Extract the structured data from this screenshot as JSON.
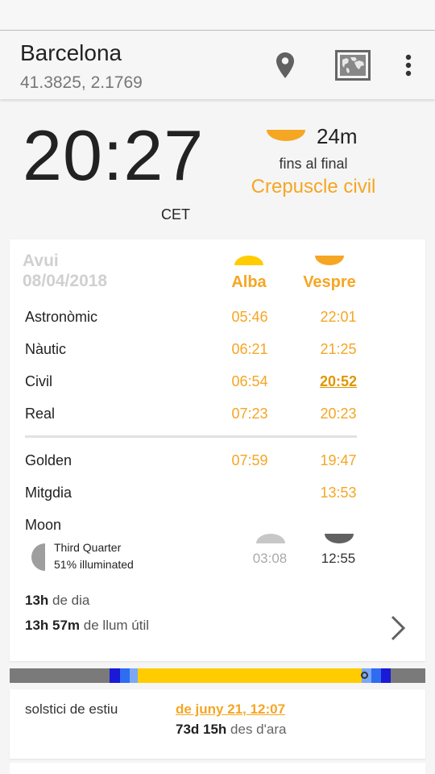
{
  "header": {
    "title": "Barcelona",
    "coords": "41.3825, 2.1769",
    "actions": {
      "location": "location-pin-icon",
      "map": "world-map-icon",
      "more": "more-vertical-icon"
    }
  },
  "now": {
    "time": "20:27",
    "timezone": "CET",
    "countdown": "24m",
    "until_label": "fins al final",
    "phase": "Crepuscle civil"
  },
  "day": {
    "label": "Avui",
    "date": "08/04/2018",
    "headers": {
      "dawn": "Alba",
      "dusk": "Vespre"
    },
    "rows": [
      {
        "label": "Astronòmic",
        "dawn": "05:46",
        "dusk": "22:01"
      },
      {
        "label": "Nàutic",
        "dawn": "06:21",
        "dusk": "21:25"
      },
      {
        "label": "Civil",
        "dawn": "06:54",
        "dusk": "20:52"
      },
      {
        "label": "Real",
        "dawn": "07:23",
        "dusk": "20:23"
      }
    ],
    "golden": {
      "label": "Golden",
      "dawn": "07:59",
      "dusk": "19:47"
    },
    "noon": {
      "label": "Mitgdia",
      "value": "13:53"
    },
    "moon": {
      "label": "Moon",
      "phase": "Third Quarter",
      "illumination": "51% illuminated",
      "rise": "03:08",
      "set": "12:55"
    },
    "day_length": {
      "value": "13h",
      "suffix": "de dia"
    },
    "useful_light": {
      "value": "13h 57m",
      "suffix": "de llum útil"
    }
  },
  "event": {
    "name": "solstici de estiu",
    "date": "de juny 21, 12:07",
    "until_value": "73d 15h",
    "until_suffix": "des d'ara"
  },
  "colors": {
    "accent": "#f5a623",
    "sun": "#ffcc00",
    "night": "#7a7a7a",
    "twilight_dark": "#1a1ad6",
    "twilight_mid": "#2f6cf0",
    "twilight_light": "#7aa8f5"
  }
}
